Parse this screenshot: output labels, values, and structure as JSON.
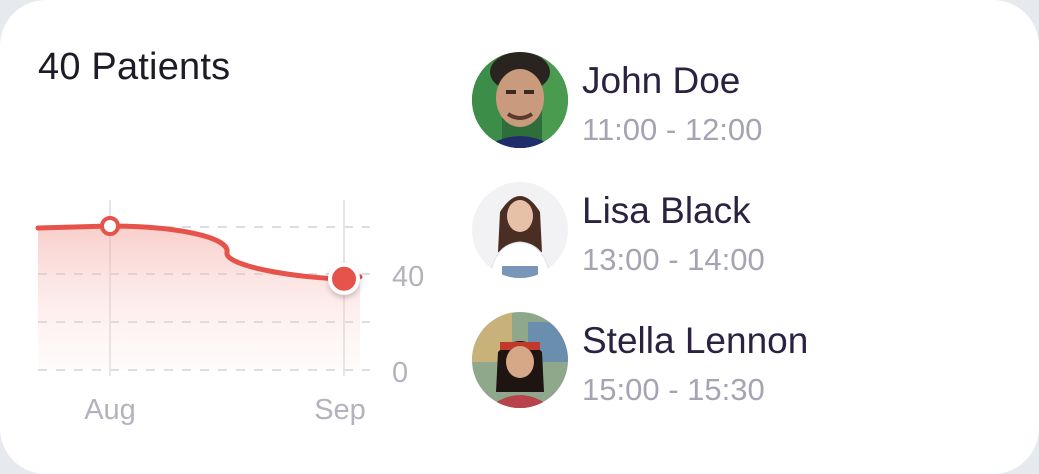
{
  "card": {
    "title": "40 Patients"
  },
  "chart_data": {
    "type": "area",
    "categories": [
      "Aug",
      "Sep"
    ],
    "series": [
      {
        "values": [
          60,
          38
        ]
      }
    ],
    "y_ticks": [
      "0",
      "40"
    ],
    "ylim": [
      0,
      80
    ],
    "color": "#e5534b",
    "grid": true
  },
  "patients": [
    {
      "name": "John Doe",
      "time": "11:00 - 12:00",
      "avatar": "avatar-john-doe"
    },
    {
      "name": "Lisa Black",
      "time": "13:00 - 14:00",
      "avatar": "avatar-lisa-black"
    },
    {
      "name": "Stella Lennon",
      "time": "15:00 - 15:30",
      "avatar": "avatar-stella-lennon"
    }
  ]
}
